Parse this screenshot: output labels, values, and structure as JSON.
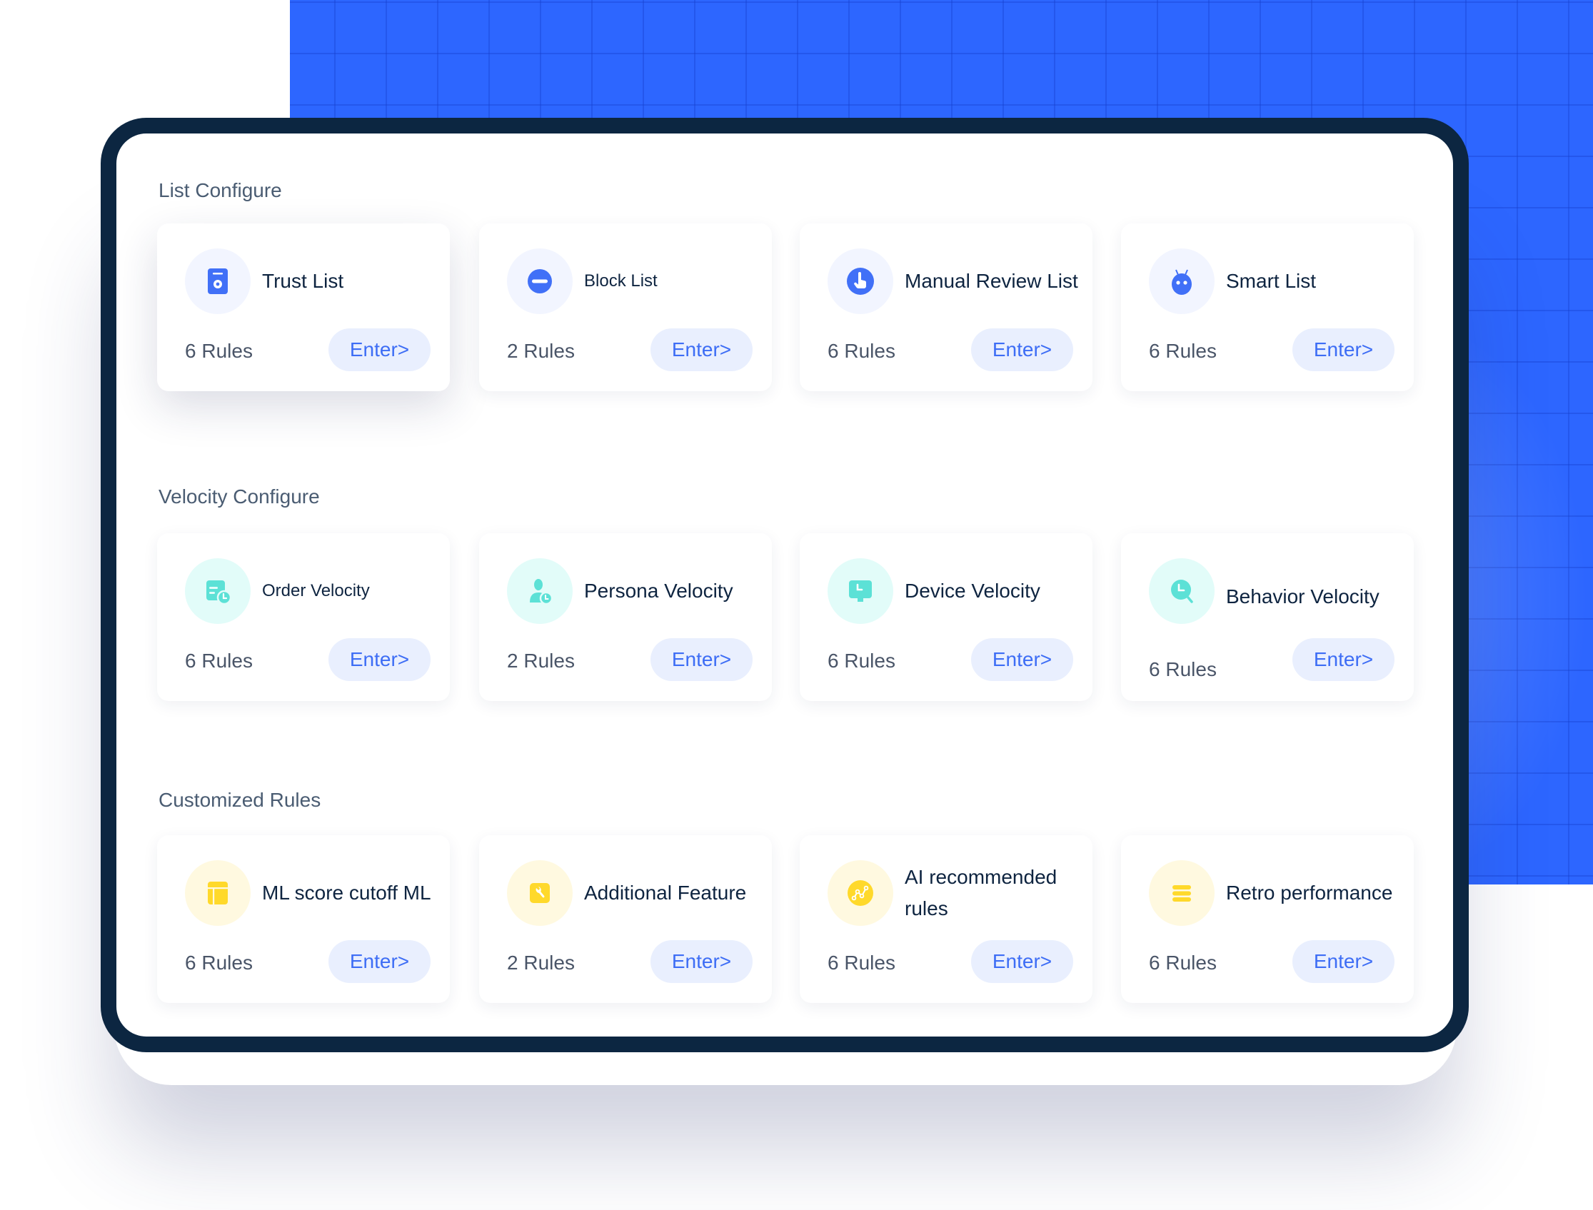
{
  "colors": {
    "brand_blue": "#2D66FF",
    "frame_navy": "#0C2641",
    "button_bg": "#E9EFFE",
    "button_text": "#3D6DF5",
    "teal": "#5CE1D6",
    "yellow": "#FFD92B",
    "icon_blue": "#4170F7"
  },
  "sections": [
    {
      "title": "List Configure",
      "cards": [
        {
          "title": "Trust List",
          "icon": "badge-gear-icon",
          "rules": "6 Rules",
          "button": "Enter>"
        },
        {
          "title": "Block List",
          "icon": "minus-circle-icon",
          "rules": "2 Rules",
          "button": "Enter>"
        },
        {
          "title": "Manual Review List",
          "icon": "hand-pointer-icon",
          "rules": "6 Rules",
          "button": "Enter>"
        },
        {
          "title": "Smart List",
          "icon": "robot-icon",
          "rules": "6 Rules",
          "button": "Enter>"
        }
      ]
    },
    {
      "title": "Velocity Configure",
      "cards": [
        {
          "title": "Order Velocity",
          "icon": "order-clock-icon",
          "rules": "6 Rules",
          "button": "Enter>"
        },
        {
          "title": "Persona Velocity",
          "icon": "user-clock-icon",
          "rules": "2 Rules",
          "button": "Enter>"
        },
        {
          "title": "Device Velocity",
          "icon": "monitor-clock-icon",
          "rules": "6 Rules",
          "button": "Enter>"
        },
        {
          "title": "Behavior Velocity",
          "icon": "clock-search-icon",
          "rules": "6 Rules",
          "button": "Enter>"
        }
      ]
    },
    {
      "title": "Customized Rules",
      "cards": [
        {
          "title": "ML score cutoff ML",
          "icon": "layout-icon",
          "rules": "6 Rules",
          "button": "Enter>"
        },
        {
          "title": "Additional Feature",
          "icon": "wrench-icon",
          "rules": "2 Rules",
          "button": "Enter>"
        },
        {
          "title": "AI recommended rules",
          "icon": "line-chart-icon",
          "rules": "6 Rules",
          "button": "Enter>"
        },
        {
          "title": "Retro performance",
          "icon": "menu-lines-icon",
          "rules": "6 Rules",
          "button": "Enter>"
        }
      ]
    }
  ]
}
